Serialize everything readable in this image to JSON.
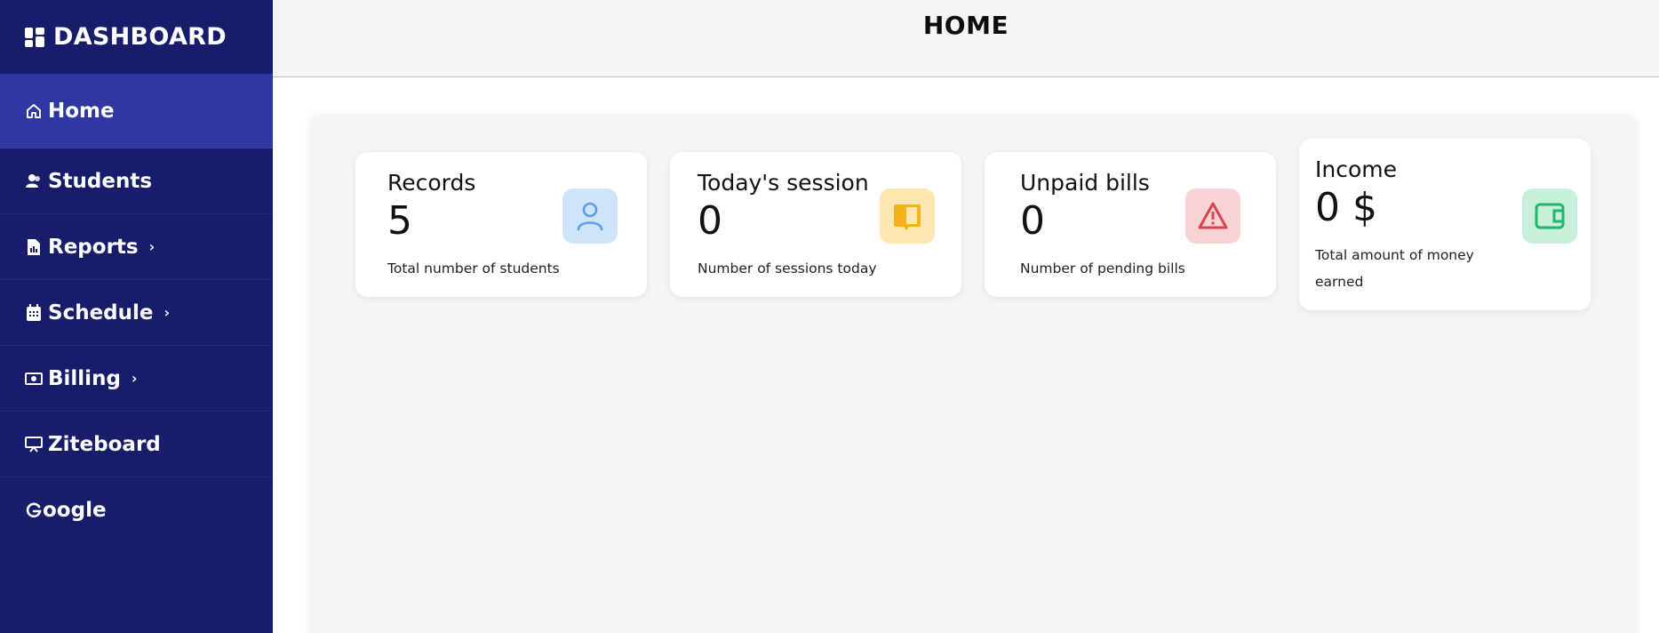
{
  "sidebar": {
    "brand": "DASHBOARD",
    "items": [
      {
        "label": "Home",
        "icon": "home-icon",
        "active": true
      },
      {
        "label": "Students",
        "icon": "users-icon"
      },
      {
        "label": "Reports",
        "icon": "report-file-icon",
        "chevron": true
      },
      {
        "label": "Schedule",
        "icon": "calendar-icon",
        "chevron": true
      },
      {
        "label": "Billing",
        "icon": "money-bill-icon",
        "chevron": true
      },
      {
        "label": "Ziteboard",
        "icon": "whiteboard-icon"
      },
      {
        "label": "oogle",
        "icon": "google-g-icon"
      }
    ]
  },
  "header": {
    "title": "HOME"
  },
  "cards": [
    {
      "title": "Records",
      "value": "5",
      "description": "Total number of students",
      "icon": "user-icon",
      "badge_color": "#cfe4fb",
      "icon_color": "#5aa0e8"
    },
    {
      "title": "Today's session",
      "value": "0",
      "description": "Number of sessions today",
      "icon": "book-icon",
      "badge_color": "#fde6b0",
      "icon_color": "#f5b11a"
    },
    {
      "title": "Unpaid bills",
      "value": "0",
      "description": "Number of pending bills",
      "icon": "warning-icon",
      "badge_color": "#f7d3d6",
      "icon_color": "#d9434f"
    },
    {
      "title": "Income",
      "value": "0 $",
      "description": "Total amount of money earned",
      "icon": "wallet-icon",
      "badge_color": "#c7efd9",
      "icon_color": "#21b66a"
    }
  ]
}
